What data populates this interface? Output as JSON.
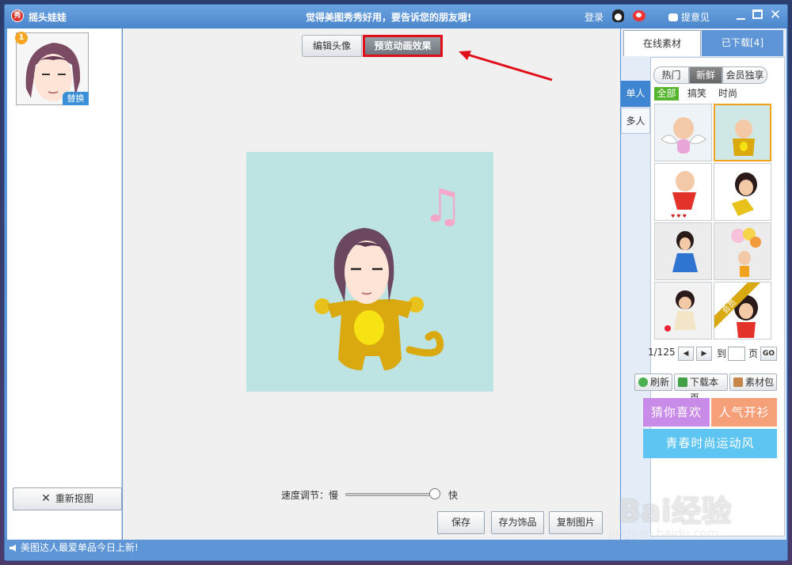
{
  "titlebar": {
    "app_icon": "秀",
    "app_title": "摇头娃娃",
    "slogan": "觉得美图秀秀好用，要告诉您的朋友哦!",
    "login": "登录",
    "feedback": "提意见",
    "close": "✕"
  },
  "left": {
    "badge": "1",
    "replace": "替换",
    "recrop": "重新抠图",
    "recrop_icon": "✕"
  },
  "center": {
    "tabs": {
      "edit": "编辑头像",
      "preview": "预览动画效果"
    },
    "speed_label": "速度调节：慢",
    "speed_fast": "快",
    "speed_value": 0.95,
    "buttons": {
      "save": "保存",
      "save_as": "存为饰品",
      "copy": "复制图片"
    },
    "music_note": "♫"
  },
  "right": {
    "tabs": {
      "online": "在线素材",
      "downloaded": "已下载[4]"
    },
    "segments": [
      "热门",
      "新鲜",
      "会员独享"
    ],
    "filters": [
      "全部",
      "搞笑",
      "时尚"
    ],
    "side_tabs": [
      "单人",
      "多人"
    ],
    "grid_badge": "会员",
    "pager": {
      "page": "1/125",
      "goto": "到",
      "unit": "页",
      "go": "GO",
      "prev": "◀",
      "next": "▶"
    },
    "tools": {
      "refresh": "刷新",
      "download_page": "下载本页",
      "pack": "素材包"
    },
    "promos": {
      "guess": "猜你喜欢",
      "popular": "人气开衫",
      "youth": "青春时尚运动风"
    }
  },
  "statusbar": {
    "text": "美图达人最爱单品今日上新!"
  },
  "watermark": {
    "big": "Bai经验",
    "small": "jingyan.baidu.com"
  },
  "colors": {
    "titlebar": "#5d95d6",
    "highlight": "#e0101a",
    "canvas_bg": "#bde3e2",
    "promo_purple": "#c98be8",
    "promo_orange": "#f6a07a",
    "promo_blue": "#5ec5f2",
    "filter_active": "#55b52c"
  }
}
